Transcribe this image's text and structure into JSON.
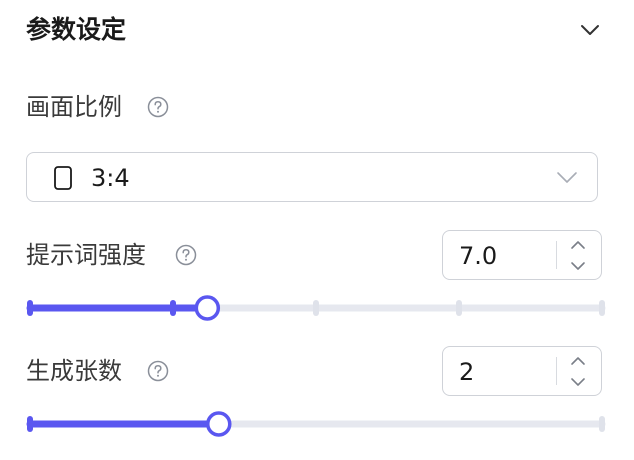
{
  "panel": {
    "title": "参数设定",
    "collapse_icon": "chevron-down-icon"
  },
  "aspect_ratio": {
    "label": "画面比例",
    "help_icon": "help-circle-icon",
    "selected": "3:4",
    "ratio_icon": "portrait-rectangle-icon",
    "dropdown_icon": "chevron-down-icon"
  },
  "prompt_strength": {
    "label": "提示词强度",
    "help_icon": "help-circle-icon",
    "value": "7.0",
    "slider_fraction": 0.31,
    "marks": [
      0,
      0.25,
      0.5,
      0.75,
      1.0
    ]
  },
  "image_count": {
    "label": "生成张数",
    "help_icon": "help-circle-icon",
    "value": "2",
    "slider_fraction": 0.33,
    "marks": [
      0,
      1.0
    ]
  },
  "colors": {
    "accent": "#5a57f0",
    "track": "#e6e8ef",
    "border": "#cfd2d8"
  }
}
